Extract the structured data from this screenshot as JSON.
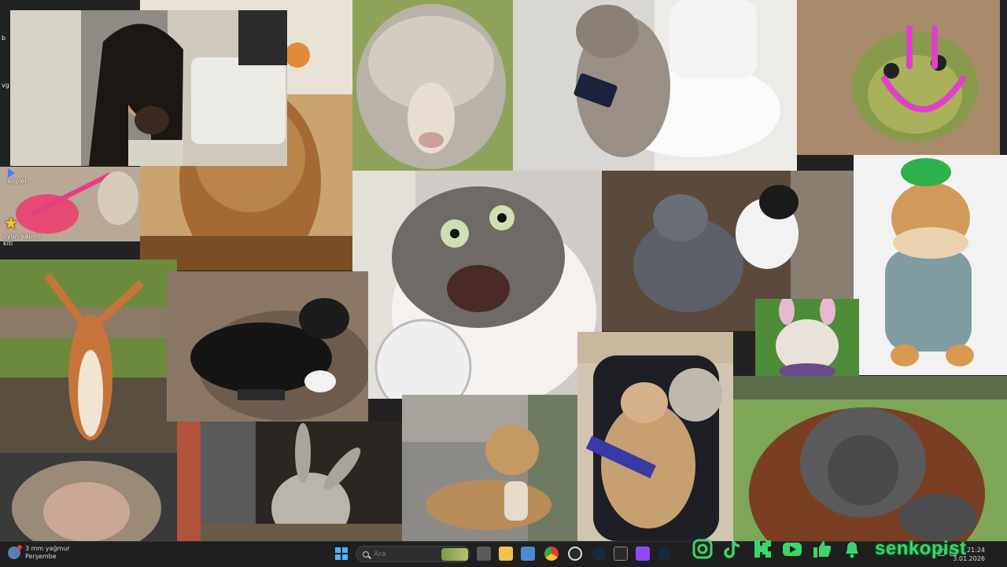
{
  "desktop": {
    "icons": [
      {
        "label": "b",
        "icon": "folder-icon"
      },
      {
        "label": "vg",
        "icon": "folder-icon"
      },
      {
        "label": "klipler",
        "icon": "clips-icon"
      },
      {
        "label": "oyun yapım kiti",
        "icon": "star-icon"
      }
    ]
  },
  "tiles": [
    {
      "name": "webcam-feed",
      "desc": "streamer webcam"
    },
    {
      "name": "sheep-photo",
      "desc": "curly sheep"
    },
    {
      "name": "cat-toilet-photo",
      "desc": "cat on toilet with phone"
    },
    {
      "name": "frog-photo",
      "desc": "frog in sand"
    },
    {
      "name": "fluffy-cat-photo",
      "desc": "fluffy cat"
    },
    {
      "name": "shocked-cat-photo",
      "desc": "shocked cat"
    },
    {
      "name": "dogs-fighting-photo",
      "desc": "dog and cat"
    },
    {
      "name": "hat-cat-photo",
      "desc": "cat wearing hat"
    },
    {
      "name": "squirrel-photo",
      "desc": "squirrel arms up"
    },
    {
      "name": "black-dog-photo",
      "desc": "black dog gaming"
    },
    {
      "name": "bulldog-bunny-photo",
      "desc": "bulldog with bunny ears"
    },
    {
      "name": "monkey-photo",
      "desc": "monkey"
    },
    {
      "name": "donkey-photo",
      "desc": "donkey"
    },
    {
      "name": "puppy-bread-photo",
      "desc": "puppy with bread"
    },
    {
      "name": "gamer-cat-photo",
      "desc": "cat in gaming chair"
    },
    {
      "name": "orangutan-photo",
      "desc": "orangutan"
    },
    {
      "name": "small-pet-photo",
      "desc": "pink leash"
    }
  ],
  "taskbar": {
    "weather_temp": "3 mm yağmur",
    "weather_day": "Perşembe",
    "search_placeholder": "Ara",
    "apps": [
      "task-view",
      "file-explorer",
      "store",
      "chrome",
      "obs",
      "steam",
      "epic-games",
      "twitch",
      "steam-2"
    ],
    "time": "21:24",
    "date": "3.01.2026"
  },
  "overlay": {
    "brand": "senkopist",
    "brand_color": "#3bd66b",
    "socials": [
      "instagram-icon",
      "tiktok-icon",
      "kick-icon",
      "youtube-icon",
      "like-icon",
      "bell-icon"
    ]
  },
  "colors": {
    "smile": "#e040c8",
    "start": "#4fb3ff"
  }
}
